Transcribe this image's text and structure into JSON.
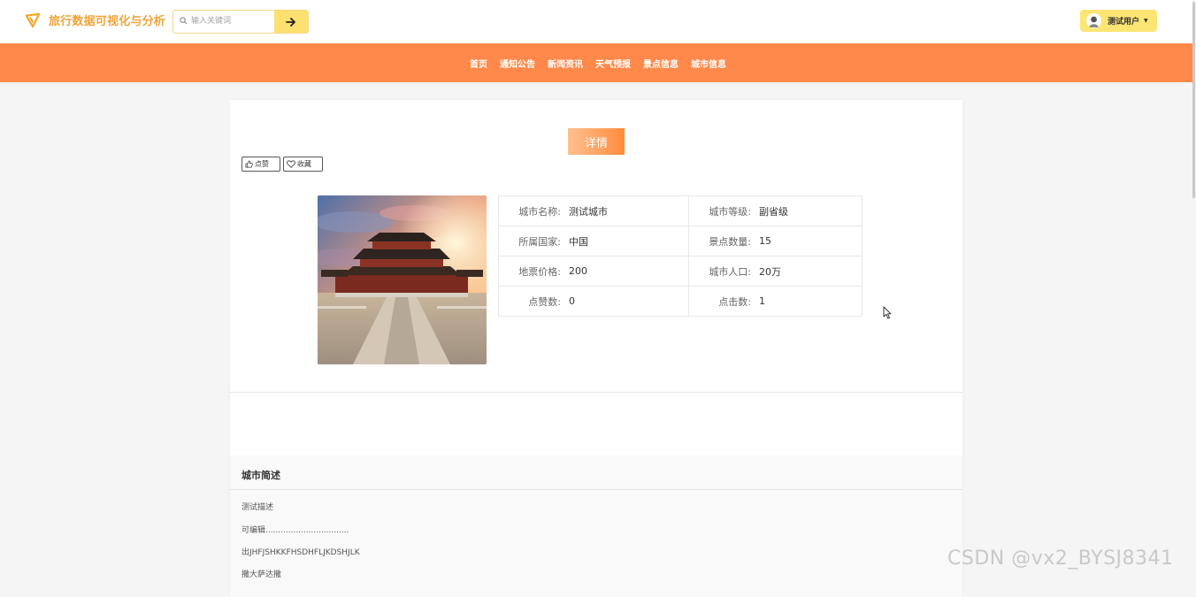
{
  "header": {
    "brand_title": "旅行数据可视化与分析",
    "search_placeholder": "输入关键词",
    "user_name": "测试用户"
  },
  "nav": {
    "items": [
      "首页",
      "通知公告",
      "新闻资讯",
      "天气预报",
      "景点信息",
      "城市信息"
    ]
  },
  "detail": {
    "title": "详情",
    "like_label": "点赞",
    "favorite_label": "收藏",
    "fields": [
      [
        {
          "label": "城市名称:",
          "value": "测试城市"
        },
        {
          "label": "城市等级:",
          "value": "副省级"
        }
      ],
      [
        {
          "label": "所属国家:",
          "value": "中国"
        },
        {
          "label": "景点数量:",
          "value": "15"
        }
      ],
      [
        {
          "label": "地票价格:",
          "value": "200"
        },
        {
          "label": "城市人口:",
          "value": "20万"
        }
      ],
      [
        {
          "label": "点赞数:",
          "value": "0"
        },
        {
          "label": "点击数:",
          "value": "1"
        }
      ]
    ]
  },
  "description": {
    "title": "城市简述",
    "lines": [
      "测试描述",
      "可编辑.................................",
      "出JHFJSHKKFHSDHFLJKDSHJLK",
      "撒大萨达撒"
    ]
  },
  "watermark": "CSDN @vx2_BYSJ8341",
  "colors": {
    "nav_bg": "#ff894a",
    "accent_yellow": "#fde06f",
    "brand_orange": "#f0a43a"
  }
}
